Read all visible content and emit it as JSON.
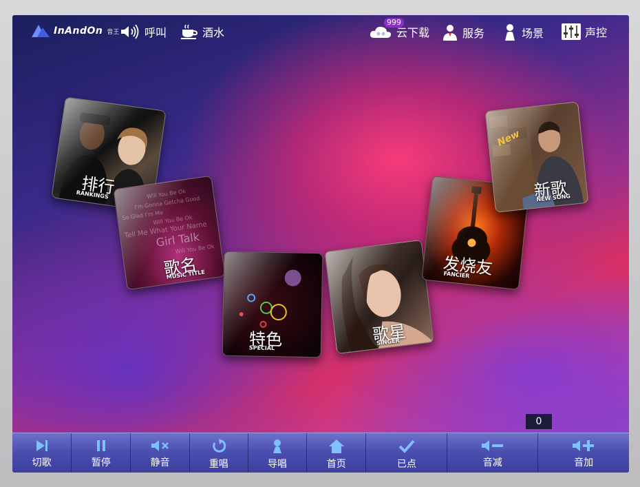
{
  "header": {
    "brand": "InAndOn",
    "brand_sub": "音王",
    "call_label": "呼叫",
    "drinks_label": "酒水",
    "cloud_download_label": "云下载",
    "cloud_download_badge": "999",
    "service_label": "服务",
    "scene_label": "场景",
    "sound_control_label": "声控"
  },
  "tiles": {
    "rankings": {
      "cn": "排行",
      "en": "RANKINGS"
    },
    "music_title": {
      "cn": "歌名",
      "en": "MUSIC TITLE",
      "lyrics": [
        "Will You Be Ok",
        "I'm Gonna Getcha Good",
        "So Glad I'm Me",
        "Will You Be Ok",
        "Tell Me What Your Name",
        "Girl Talk",
        "Will You Be Ok"
      ]
    },
    "special": {
      "cn": "特色",
      "en": "SPECIAL"
    },
    "singer": {
      "cn": "歌星",
      "en": "SINGER"
    },
    "fancier": {
      "cn": "发烧友",
      "en": "FANCIER"
    },
    "new_song": {
      "cn": "新歌",
      "en": "NEW SONG",
      "tag": "New"
    }
  },
  "queue_count": "0",
  "bottom": {
    "skip": "切歌",
    "pause": "暂停",
    "mute": "静音",
    "replay": "重唱",
    "guide_vocal": "导唱",
    "home": "首页",
    "ordered": "已点",
    "vol_down": "音减",
    "vol_up": "音加"
  }
}
